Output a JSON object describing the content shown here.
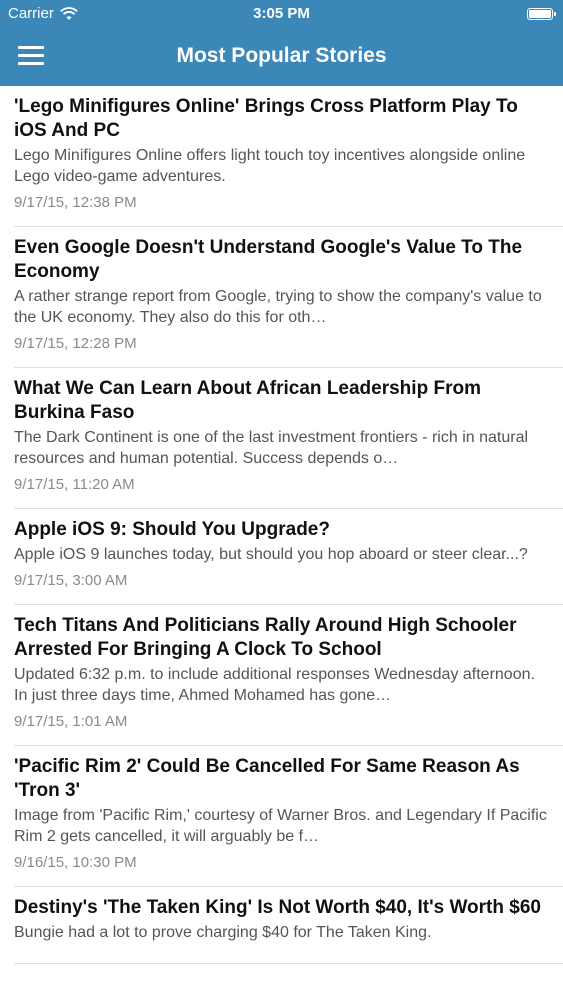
{
  "status_bar": {
    "carrier": "Carrier",
    "time": "3:05 PM"
  },
  "nav": {
    "title": "Most Popular Stories"
  },
  "colors": {
    "header_bg": "#3a87b8",
    "header_text": "#ffffff",
    "title_text": "#111111",
    "summary_text": "#555555",
    "date_text": "#8a8a8a",
    "separator": "#e2e2e2"
  },
  "icons": {
    "menu": "hamburger-menu-icon",
    "wifi": "wifi-icon",
    "battery": "battery-icon"
  },
  "stories": [
    {
      "title": "'Lego Minifigures Online' Brings Cross Platform Play To iOS And PC",
      "summary": "Lego Minifigures Online offers light touch toy incentives alongside online Lego video-game adventures.",
      "date": "9/17/15, 12:38 PM"
    },
    {
      "title": "Even Google Doesn't Understand Google's Value To The Economy",
      "summary": "A rather strange report from Google, trying to show the company's value to the UK economy. They also do this for oth…",
      "date": "9/17/15, 12:28 PM"
    },
    {
      "title": "What We Can Learn About African Leadership From Burkina Faso",
      "summary": "The Dark Continent is one of the last investment frontiers - rich in natural resources and human potential. Success depends o…",
      "date": "9/17/15, 11:20 AM"
    },
    {
      "title": "Apple iOS 9: Should You Upgrade?",
      "summary": "Apple iOS 9 launches today, but should you hop aboard or steer clear...?",
      "date": "9/17/15, 3:00 AM"
    },
    {
      "title": "Tech Titans And Politicians Rally Around High Schooler Arrested For Bringing A Clock To School",
      "summary": "Updated 6:32 p.m. to include additional responses Wednesday afternoon. In just three days time, Ahmed Mohamed has gone…",
      "date": "9/17/15, 1:01 AM"
    },
    {
      "title": "'Pacific Rim 2' Could Be Cancelled For Same Reason As 'Tron 3'",
      "summary": "Image from 'Pacific Rim,' courtesy of Warner Bros. and Legendary If Pacific Rim 2 gets cancelled, it will arguably be f…",
      "date": "9/16/15, 10:30 PM"
    },
    {
      "title": "Destiny's 'The Taken King' Is Not Worth $40, It's Worth $60",
      "summary": "Bungie had a lot to prove charging $40 for The Taken King.",
      "date": ""
    }
  ]
}
